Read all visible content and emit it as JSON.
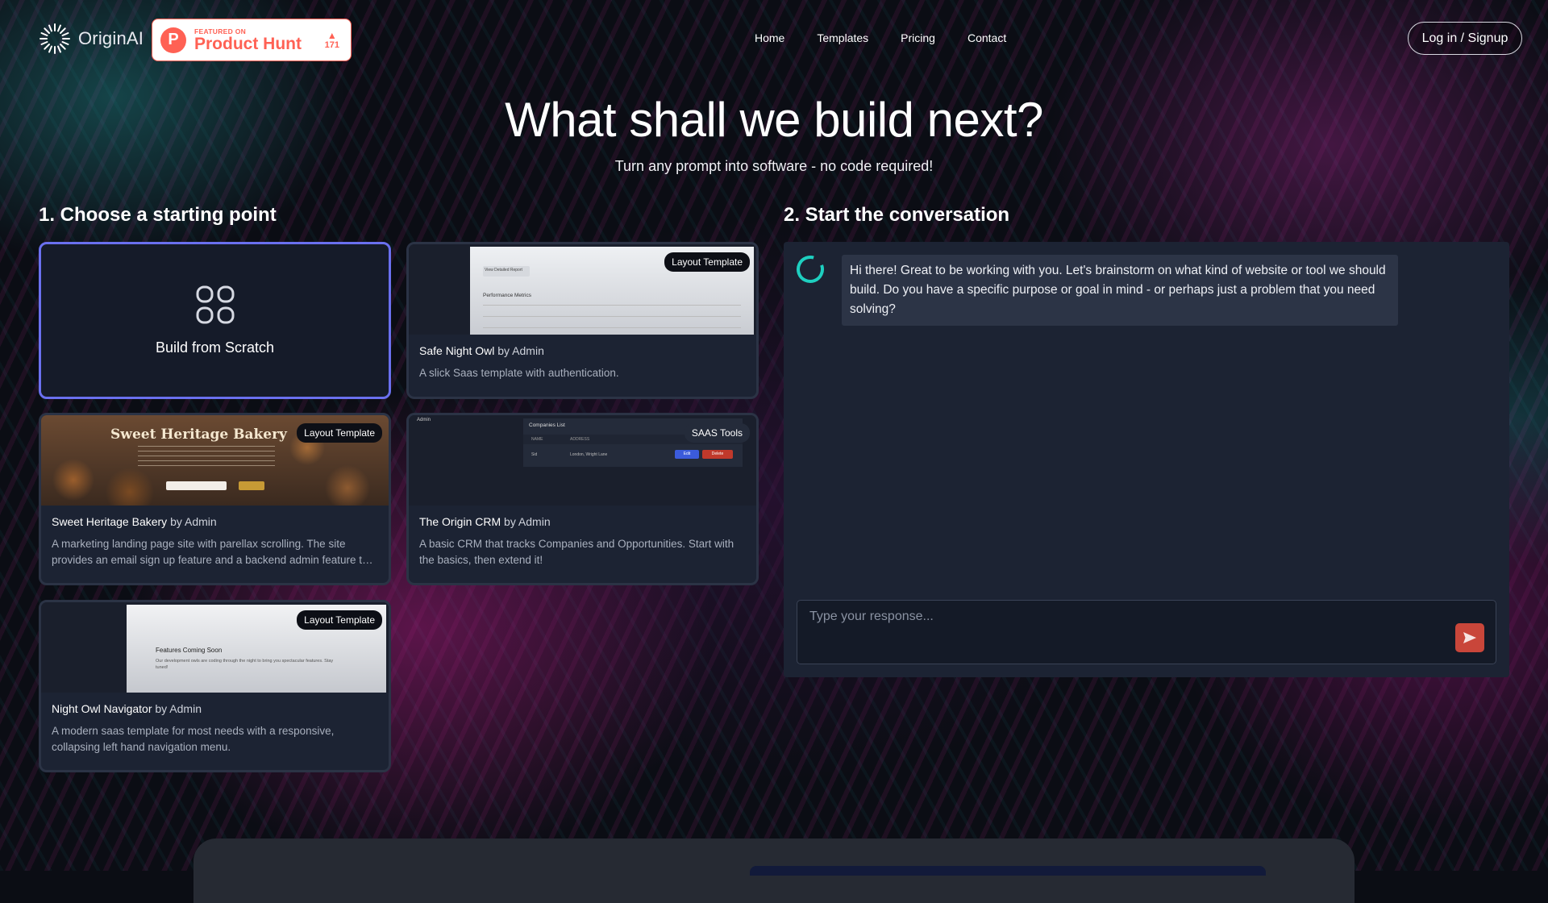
{
  "header": {
    "logo_text": "OriginAI",
    "product_hunt": {
      "featured_label": "FEATURED ON",
      "name": "Product Hunt",
      "votes": "171",
      "logo_letter": "P"
    },
    "nav": [
      "Home",
      "Templates",
      "Pricing",
      "Contact"
    ],
    "login_label": "Log in / Signup"
  },
  "hero": {
    "title": "What shall we build next?",
    "subtitle": "Turn any prompt into software - no code required!"
  },
  "step1": {
    "title": "1. Choose a starting point",
    "scratch_label": "Build from Scratch",
    "templates": [
      {
        "badge": "Layout Template",
        "name": "Safe Night Owl",
        "by": "by Admin",
        "description": "A slick Saas template with authentication.",
        "thumb": {
          "section": "Performance Metrics",
          "btn": "View Detailed Report"
        }
      },
      {
        "badge": "Layout Template",
        "name": "Sweet Heritage Bakery",
        "by": "by Admin",
        "description": "A marketing landing page site with parellax scrolling. The site provides an email sign up feature and a backend admin feature to manage subscribers.",
        "thumb": {
          "heading": "Sweet Heritage Bakery"
        }
      },
      {
        "badge": "SAAS Tools",
        "name": "The Origin CRM",
        "by": "by Admin",
        "description": "A basic CRM that tracks Companies and Opportunities. Start with the basics, then extend it!",
        "thumb": {
          "list_title": "Companies List",
          "col1": "NAME",
          "col2": "ADDRESS",
          "row_name": "Sid",
          "row_addr": "London, Wright Lane",
          "edit": "Edit",
          "delete": "Delete",
          "admin": "Admin"
        }
      },
      {
        "badge": "Layout Template",
        "name": "Night Owl Navigator",
        "by": "by Admin",
        "description": "A modern saas template for most needs with a responsive, collapsing left hand navigation menu.",
        "thumb": {
          "heading": "Features Coming Soon",
          "body": "Our development owls are coding through the night to bring you spectacular features. Stay tuned!"
        }
      }
    ]
  },
  "step2": {
    "title": "2. Start the conversation",
    "assistant_message": "Hi there! Great to be working with you. Let's brainstorm on what kind of website or tool we should build. Do you have a specific purpose or goal in mind - or perhaps just a problem that you need solving?",
    "input_placeholder": "Type your response..."
  },
  "colors": {
    "accent": "#6a70ef",
    "send": "#c9463a",
    "product_hunt": "#ff6154",
    "assistant_ring": "#1ecfc0"
  }
}
